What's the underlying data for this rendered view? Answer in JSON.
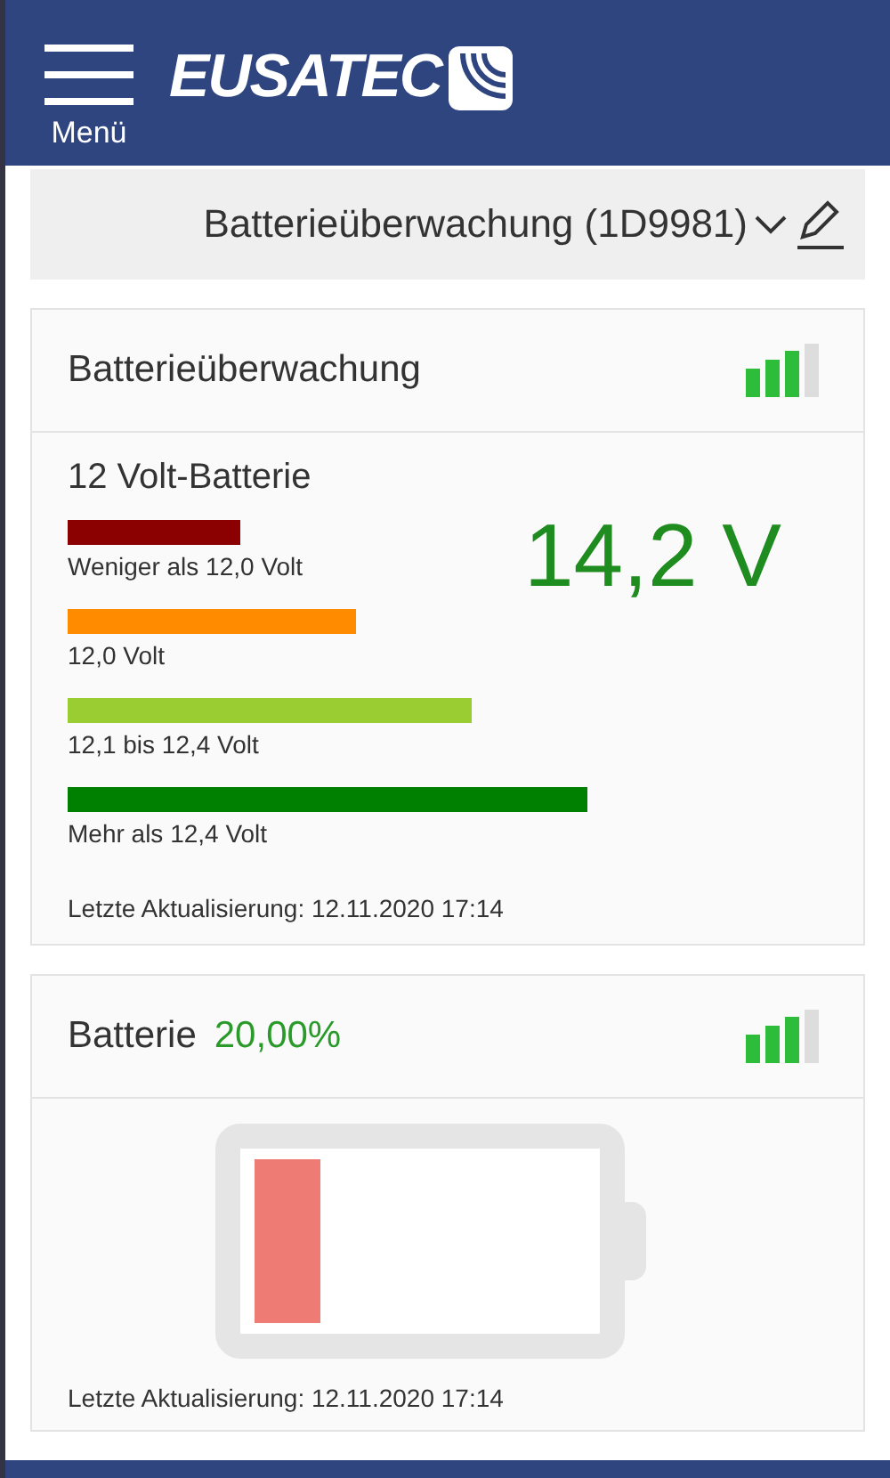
{
  "header": {
    "menu_label": "Menü",
    "logo": "EUSATEC"
  },
  "device_select": {
    "value": "Batterieüberwachung (1D9981)"
  },
  "monitor_card": {
    "title": "Batterieüberwachung",
    "subtitle": "12 Volt-Batterie",
    "reading": "14,2 V",
    "legend": [
      {
        "label": "Weniger als 12,0 Volt",
        "color": "#8b0000"
      },
      {
        "label": "12,0 Volt",
        "color": "#ff8c00"
      },
      {
        "label": "12,1 bis 12,4 Volt",
        "color": "#9acd32"
      },
      {
        "label": "Mehr als 12,4 Volt",
        "color": "#008000"
      }
    ],
    "last_update": "Letzte Aktualisierung: 12.11.2020 17:14"
  },
  "battery_card": {
    "title": "Batterie",
    "percent": "20,00%",
    "last_update": "Letzte Aktualisierung: 12.11.2020 17:14"
  }
}
